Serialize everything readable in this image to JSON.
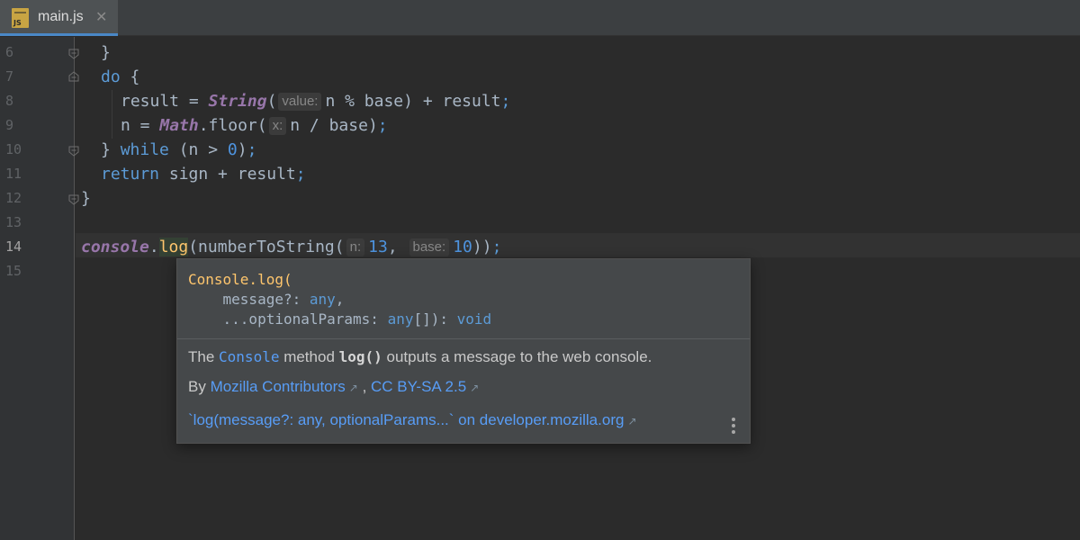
{
  "tab": {
    "icon_text": "JS",
    "filename": "main.js",
    "close": "✕"
  },
  "line_numbers": [
    "6",
    "7",
    "8",
    "9",
    "10",
    "11",
    "12",
    "13",
    "14",
    "15"
  ],
  "code": {
    "l6": "}",
    "l7_kw": "do",
    "l7_brace": " {",
    "l8_a": "result = ",
    "l8_fn": "String",
    "l8_paren": "(",
    "l8_hint": "value:",
    "l8_b": "n % base) + result",
    "l8_semi": ";",
    "l9_a": "n = ",
    "l9_obj": "Math",
    "l9_dot": ".floor(",
    "l9_hint": "x:",
    "l9_b": "n / base)",
    "l9_semi": ";",
    "l10_a": "} ",
    "l10_kw": "while",
    "l10_b": " (n > ",
    "l10_num": "0",
    "l10_c": ")",
    "l10_semi": ";",
    "l11_kw": "return",
    "l11_b": " sign + result",
    "l11_semi": ";",
    "l12": "}",
    "l14_obj": "console",
    "l14_dot": ".",
    "l14_fn": "log",
    "l14_a": "(numberToString(",
    "l14_hint1": "n:",
    "l14_num1": "13",
    "l14_comma": ", ",
    "l14_hint2": "base:",
    "l14_num2": "10",
    "l14_b": "))",
    "l14_semi": ";"
  },
  "popup": {
    "sig_line1_fn": "Console.log(",
    "sig_line2_a": "    message?: ",
    "sig_line2_type": "any",
    "sig_line2_b": ",",
    "sig_line3_a": "    ...optionalParams: ",
    "sig_line3_type": "any",
    "sig_line3_b": "[]): ",
    "sig_line3_ret": "void",
    "desc_a": "The ",
    "desc_link": "Console",
    "desc_b": " method ",
    "desc_code": "log()",
    "desc_c": " outputs a message to the web console.",
    "by": "By ",
    "contributors": "Mozilla Contributors",
    "sep": " , ",
    "license": "CC BY-SA 2.5",
    "external_arrow": "↗",
    "mdn_link": "`log(message?: any, optionalParams...` on developer.mozilla.org"
  },
  "colors": {
    "background": "#2b2b2b",
    "keyword": "#5c9bd6",
    "number": "#4e94e0",
    "link": "#589df6",
    "function": "#ffc66d"
  }
}
